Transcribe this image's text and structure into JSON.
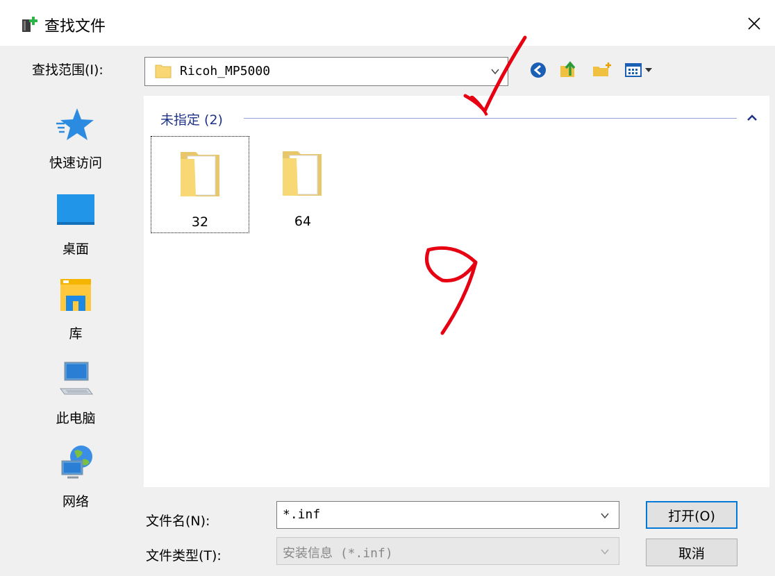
{
  "window": {
    "title": "查找文件"
  },
  "lookin": {
    "label": "查找范围(I):",
    "value": "Ricoh_MP5000"
  },
  "places": [
    {
      "label": "快速访问",
      "icon": "star-icon"
    },
    {
      "label": "桌面",
      "icon": "desktop-icon"
    },
    {
      "label": "库",
      "icon": "library-icon"
    },
    {
      "label": "此电脑",
      "icon": "computer-icon"
    },
    {
      "label": "网络",
      "icon": "network-icon"
    }
  ],
  "filelist": {
    "group_title": "未指定 (2)",
    "items": [
      {
        "name": "32",
        "icon": "folder-icon"
      },
      {
        "name": "64",
        "icon": "folder-icon"
      }
    ]
  },
  "bottom": {
    "filename_label": "文件名(N):",
    "filename_value": "*.inf",
    "filetype_label": "文件类型(T):",
    "filetype_value": "安装信息 (*.inf)",
    "open_label": "打开(O)",
    "cancel_label": "取消"
  },
  "colors": {
    "group_title": "#1e3287",
    "annotation": "#e60012",
    "accent_button": "#0078d7"
  }
}
